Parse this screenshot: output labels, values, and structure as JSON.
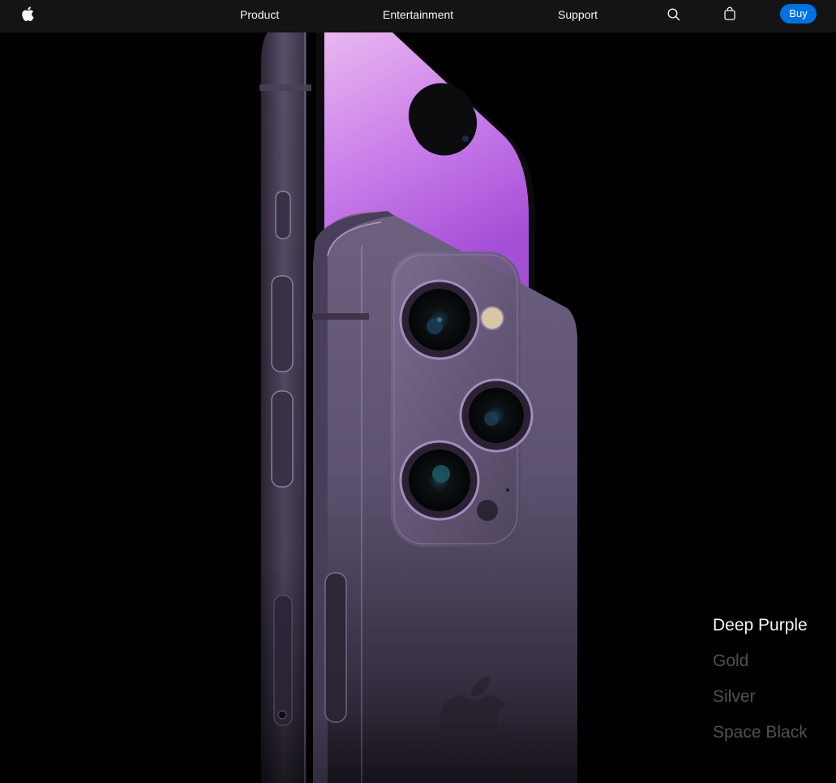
{
  "nav": {
    "logo_icon": "apple-logo-icon",
    "links": [
      "Product",
      "Entertainment",
      "Support"
    ],
    "search_icon": "search-icon",
    "bag_icon": "shopping-bag-icon",
    "buy_label": "Buy"
  },
  "hero": {
    "image": "iphone-deep-purple-back-side-view"
  },
  "colors": {
    "options": [
      "Deep Purple",
      "Gold",
      "Silver",
      "Space Black"
    ],
    "selected": "Deep Purple",
    "swatches": {
      "Deep Purple": "#5e5170",
      "Gold": "#f4e8ce",
      "Silver": "#f0f2f2",
      "Space Black": "#403e3d"
    }
  },
  "theme": {
    "nav_bg": "#141414",
    "buy_bg": "#0071e3",
    "page_bg": "#000000",
    "active_text": "#f5f5f7",
    "inactive_text": "#515154"
  }
}
